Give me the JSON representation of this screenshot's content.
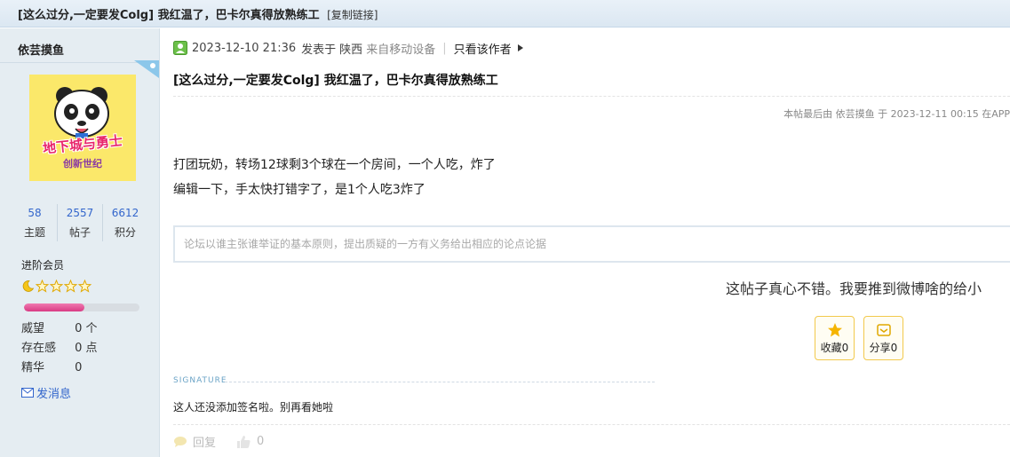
{
  "header": {
    "thread_title": "[这么过分,一定要发Colg] 我红温了，巴卡尔真得放熟练工",
    "copy_link": "[复制链接]"
  },
  "author": {
    "name": "依芸摸鱼",
    "stats": [
      {
        "value": "58",
        "label": "主题"
      },
      {
        "value": "2557",
        "label": "帖子"
      },
      {
        "value": "6612",
        "label": "积分"
      }
    ],
    "rank": "进阶会员",
    "level_progress_percent": 52,
    "attributes": [
      {
        "key": "威望",
        "value": "0 个"
      },
      {
        "key": "存在感",
        "value": "0 点"
      },
      {
        "key": "精华",
        "value": "0"
      }
    ],
    "send_message": "发消息",
    "avatar_text_top": "地下城与勇士",
    "avatar_text_bottom": "创新世纪"
  },
  "post": {
    "datetime": "2023-12-10 21:36",
    "posted_in": "发表于",
    "location": "陕西",
    "device": "来自移动设备",
    "only_author": "只看该作者",
    "title": "[这么过分,一定要发Colg] 我红温了，巴卡尔真得放熟练工",
    "last_edit": "本帖最后由 依芸摸鱼 于 2023-12-11 00:15 在APP",
    "content_lines": [
      "打团玩奶，转场12球剩3个球在一个房间，一个人吃，炸了",
      "编辑一下，手太快打错字了，是1个人吃3炸了"
    ]
  },
  "reply_box": {
    "placeholder": "论坛以谁主张谁举证的基本原则，提出质疑的一方有义务给出相应的论点论据"
  },
  "share_promo": "这帖子真心不错。我要推到微博啥的给小",
  "actions": {
    "favorite": "收藏0",
    "share": "分享0"
  },
  "signature": {
    "label": "SIGNATURE",
    "text": "这人还没添加签名啦。别再看她啦"
  },
  "footer": {
    "reply": "回复",
    "like_count": "0"
  },
  "colors": {
    "link": "#3366cc",
    "accent_yellow": "#f2c94c",
    "progress_pink": "#d93a84",
    "sidebar_bg": "#e5edf2"
  }
}
